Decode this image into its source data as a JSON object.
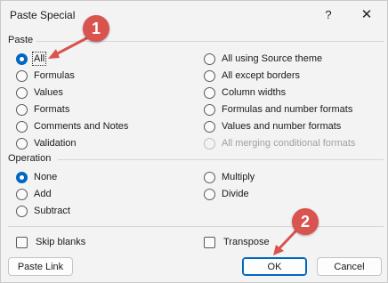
{
  "window": {
    "title": "Paste Special",
    "help_glyph": "?",
    "close_glyph": "✕"
  },
  "paste": {
    "label": "Paste",
    "left_options": [
      {
        "label": "All",
        "checked": true
      },
      {
        "label": "Formulas",
        "checked": false
      },
      {
        "label": "Values",
        "checked": false
      },
      {
        "label": "Formats",
        "checked": false
      },
      {
        "label": "Comments and Notes",
        "checked": false
      },
      {
        "label": "Validation",
        "checked": false
      }
    ],
    "right_options": [
      {
        "label": "All using Source theme",
        "checked": false,
        "disabled": false
      },
      {
        "label": "All except borders",
        "checked": false,
        "disabled": false
      },
      {
        "label": "Column widths",
        "checked": false,
        "disabled": false
      },
      {
        "label": "Formulas and number formats",
        "checked": false,
        "disabled": false
      },
      {
        "label": "Values and number formats",
        "checked": false,
        "disabled": false
      },
      {
        "label": "All merging conditional formats",
        "checked": false,
        "disabled": true
      }
    ]
  },
  "operation": {
    "label": "Operation",
    "left_options": [
      {
        "label": "None",
        "checked": true
      },
      {
        "label": "Add",
        "checked": false
      },
      {
        "label": "Subtract",
        "checked": false
      }
    ],
    "right_options": [
      {
        "label": "Multiply",
        "checked": false
      },
      {
        "label": "Divide",
        "checked": false
      }
    ]
  },
  "checks": {
    "skip_blanks": "Skip blanks",
    "transpose": "Transpose"
  },
  "buttons": {
    "paste_link": "Paste Link",
    "ok": "OK",
    "cancel": "Cancel"
  },
  "annotations": {
    "step1": "1",
    "step2": "2",
    "color": "#d9534f"
  },
  "colors": {
    "accent": "#0067c0",
    "background": "#f3f3f3"
  }
}
